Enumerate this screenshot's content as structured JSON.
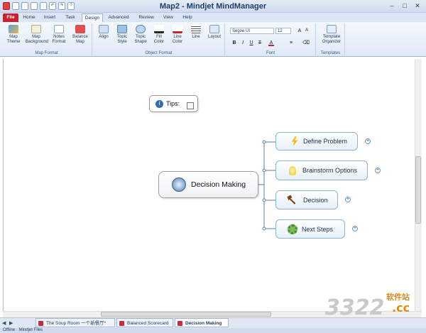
{
  "window": {
    "title": "Map2 - Mindjet MindManager"
  },
  "ribbon_tabs": [
    "File",
    "Home",
    "Insert",
    "Task",
    "Design",
    "Advanced",
    "Review",
    "View",
    "Help"
  ],
  "active_tab": "Design",
  "groups": {
    "map_format": {
      "label": "Map Format",
      "buttons": [
        {
          "line1": "Map",
          "line2": "Theme"
        },
        {
          "line1": "Map",
          "line2": "Background"
        },
        {
          "line1": "Notes",
          "line2": "Format"
        },
        {
          "line1": "Balance",
          "line2": "Map"
        }
      ]
    },
    "object_format": {
      "label": "Object Format",
      "buttons": [
        {
          "line1": "Align",
          "line2": ""
        },
        {
          "line1": "Topic",
          "line2": "Style"
        },
        {
          "line1": "Topic",
          "line2": "Shape"
        },
        {
          "line1": "Fill",
          "line2": "Color"
        },
        {
          "line1": "Line",
          "line2": "Color"
        },
        {
          "line1": "Line",
          "line2": ""
        },
        {
          "line1": "Layout",
          "line2": ""
        }
      ]
    },
    "font": {
      "label": "Font",
      "family": "Segoe UI",
      "size": "12"
    },
    "templates": {
      "label": "Templates",
      "button": {
        "line1": "Template",
        "line2": "Organizer"
      }
    }
  },
  "map": {
    "central": "Decision Making",
    "tips": "Tips:",
    "topics": [
      {
        "label": "Define Problem",
        "icon": "lightning-icon"
      },
      {
        "label": "Brainstorm Options",
        "icon": "lightbulb-icon"
      },
      {
        "label": "Decision",
        "icon": "gavel-icon"
      },
      {
        "label": "Next Steps",
        "icon": "gears-icon"
      }
    ]
  },
  "doc_tabs": [
    {
      "label": "The Soup Room 一个新餐厅*",
      "active": false
    },
    {
      "label": "Balanced Scorecard",
      "active": false
    },
    {
      "label": "Decision Making",
      "active": true
    }
  ],
  "status": {
    "text": "Offline  ·  Mindjet Files"
  },
  "watermark": {
    "text": "3322",
    "domain": ".cc",
    "site": "软件站"
  }
}
